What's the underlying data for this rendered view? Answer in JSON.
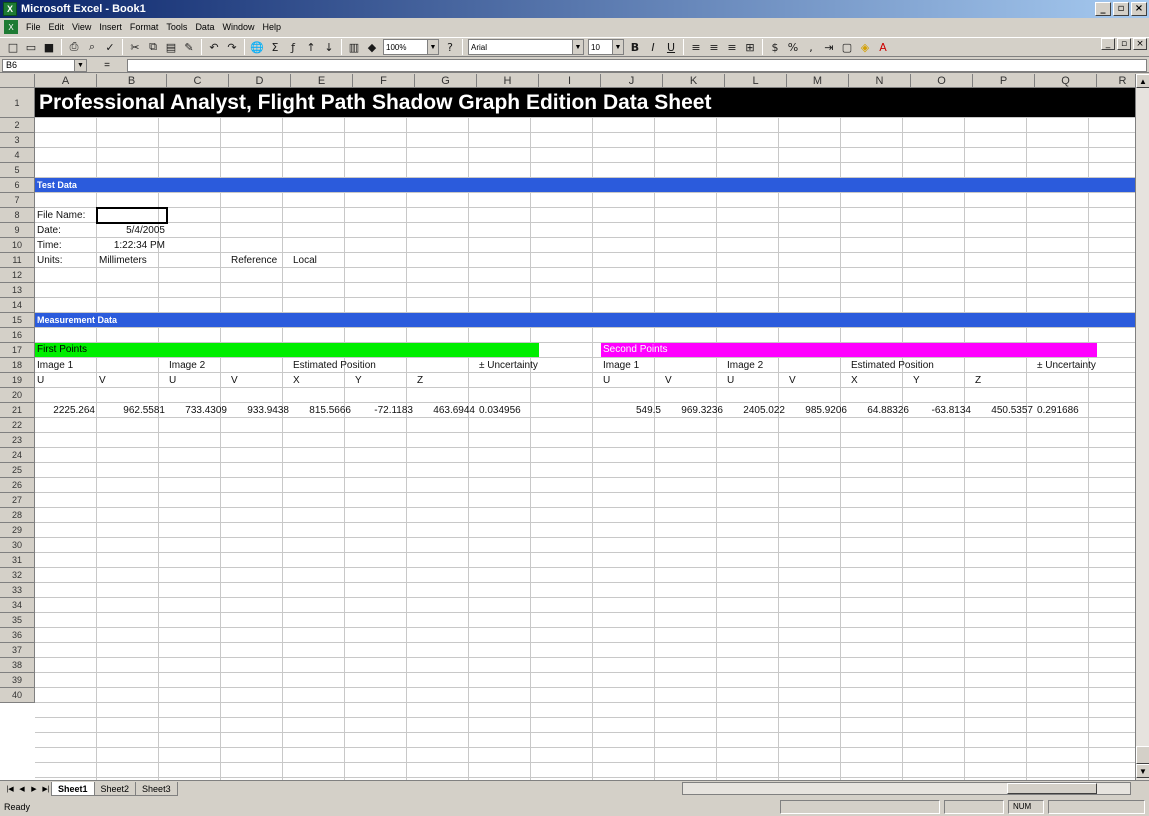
{
  "window": {
    "title": "Microsoft Excel - Book1"
  },
  "menu": [
    "File",
    "Edit",
    "View",
    "Insert",
    "Format",
    "Tools",
    "Data",
    "Window",
    "Help"
  ],
  "toolbar": {
    "zoom": "100%",
    "font": "Arial",
    "size": "10"
  },
  "formula_bar": {
    "namebox": "B6",
    "fx": "="
  },
  "columns": [
    "A",
    "B",
    "C",
    "D",
    "E",
    "F",
    "G",
    "H",
    "I",
    "J",
    "K",
    "L",
    "M",
    "N",
    "O",
    "P",
    "Q",
    "R"
  ],
  "rows": [
    "1",
    "2",
    "3",
    "4",
    "5",
    "6",
    "7",
    "8",
    "9",
    "10",
    "11",
    "12",
    "13",
    "14",
    "15",
    "16",
    "17",
    "18",
    "19",
    "20",
    "21",
    "22",
    "23",
    "24",
    "25",
    "26",
    "27",
    "28",
    "29",
    "30",
    "31",
    "32",
    "33",
    "34",
    "35",
    "36",
    "37",
    "38",
    "39",
    "40"
  ],
  "sheet": {
    "title": "Professional Analyst, Flight Path Shadow Graph Edition Data Sheet",
    "test_data": "Test Data",
    "file_name": "File Name:",
    "date_label": "Date:",
    "date_value": "5/4/2005",
    "time_label": "Time:",
    "time_value": "1:22:34 PM",
    "units_label": "Units:",
    "units_value": "Millimeters",
    "reference_label": "Reference",
    "reference_value": "Local",
    "measurement_data": "Measurement Data",
    "first_points": "First Points",
    "second_points": "Second Points",
    "image1": "Image 1",
    "image2": "Image 2",
    "estimated_position": "Estimated Position",
    "uncertainty": "± Uncertainty",
    "u": "U",
    "v": "V",
    "x": "X",
    "y": "Y",
    "z": "Z",
    "first_values": [
      "2225.264",
      "962.5581",
      "733.4309",
      "933.9438",
      "815.5666",
      "-72.1183",
      "463.6944",
      "0.034956"
    ],
    "second_values": [
      "549.5",
      "969.3236",
      "2405.022",
      "985.9206",
      "64.88326",
      "-63.8134",
      "450.5357",
      "0.291686"
    ]
  },
  "tabs": [
    "Sheet1",
    "Sheet2",
    "Sheet3"
  ],
  "status": {
    "ready": "Ready",
    "num": "NUM"
  },
  "colors": {
    "banner": "#000000",
    "section": "#2b5bdc",
    "first": "#00ee00",
    "second": "#ff00ff"
  }
}
